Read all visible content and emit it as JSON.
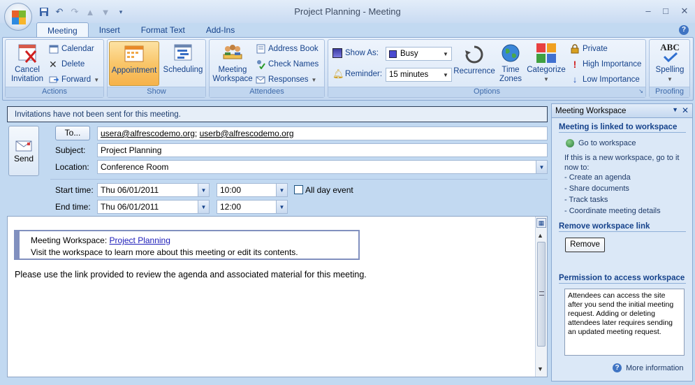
{
  "window": {
    "title": "Project Planning - Meeting",
    "minimize_glyph": "–",
    "maximize_glyph": "□",
    "close_glyph": "✕"
  },
  "qat": [
    "save-icon",
    "undo-icon",
    "redo-icon",
    "up-icon",
    "down-icon",
    "customize-icon"
  ],
  "tabs": [
    {
      "label": "Meeting",
      "active": true
    },
    {
      "label": "Insert",
      "active": false
    },
    {
      "label": "Format Text",
      "active": false
    },
    {
      "label": "Add-Ins",
      "active": false
    }
  ],
  "ribbon": {
    "actions": {
      "label": "Actions",
      "cancel_invitation": "Cancel Invitation",
      "calendar": "Calendar",
      "delete": "Delete",
      "forward": "Forward"
    },
    "show": {
      "label": "Show",
      "appointment": "Appointment",
      "scheduling": "Scheduling"
    },
    "attendees": {
      "label": "Attendees",
      "meeting_workspace": "Meeting Workspace",
      "address_book": "Address Book",
      "check_names": "Check Names",
      "responses": "Responses"
    },
    "options": {
      "label": "Options",
      "show_as_label": "Show As:",
      "show_as_value": "Busy",
      "reminder_label": "Reminder:",
      "reminder_value": "15 minutes",
      "recurrence": "Recurrence",
      "time_zones": "Time Zones",
      "categorize": "Categorize",
      "private": "Private",
      "high_importance": "High Importance",
      "low_importance": "Low Importance"
    },
    "proofing": {
      "label": "Proofing",
      "spelling": "Spelling",
      "spelling_icon_text": "ABC"
    }
  },
  "form": {
    "info_bar": "Invitations have not been sent for this meeting.",
    "send_label": "Send",
    "to_button": "To...",
    "to_value_1": "usera@alfrescodemo.org",
    "to_separator": ";",
    "to_value_2": "userb@alfrescodemo.org",
    "subject_label": "Subject:",
    "subject_value": "Project Planning",
    "location_label": "Location:",
    "location_value": "Conference Room",
    "start_label": "Start time:",
    "start_date": "Thu 06/01/2011",
    "start_time": "10:00",
    "all_day_label": "All day event",
    "all_day_checked": false,
    "end_label": "End time:",
    "end_date": "Thu 06/01/2011",
    "end_time": "12:00"
  },
  "body": {
    "workspace_prefix": "Meeting Workspace:",
    "workspace_link": "Project Planning",
    "workspace_line2": "Visit the workspace to learn more about this meeting or edit its contents.",
    "message": "Please use the link provided to review the agenda and associated material for this meeting."
  },
  "pane": {
    "title": "Meeting Workspace",
    "linked_heading": "Meeting is linked to workspace",
    "go_to_workspace": "Go to workspace",
    "new_workspace_text": "If this is a new workspace, go to it now to:",
    "bullets": [
      "- Create an agenda",
      "- Share documents",
      "- Track tasks",
      "- Coordinate meeting details"
    ],
    "remove_heading": "Remove workspace link",
    "remove_button": "Remove",
    "permission_heading": "Permission to access workspace",
    "permission_text": "Attendees can access the site after you send the initial meeting request. Adding or deleting attendees later requires sending an updated meeting request.",
    "more_info": "More information"
  },
  "colors": {
    "accent": "#15428b",
    "ribbon_bg": "#dae7f7",
    "active_button": "#f9c66a"
  }
}
